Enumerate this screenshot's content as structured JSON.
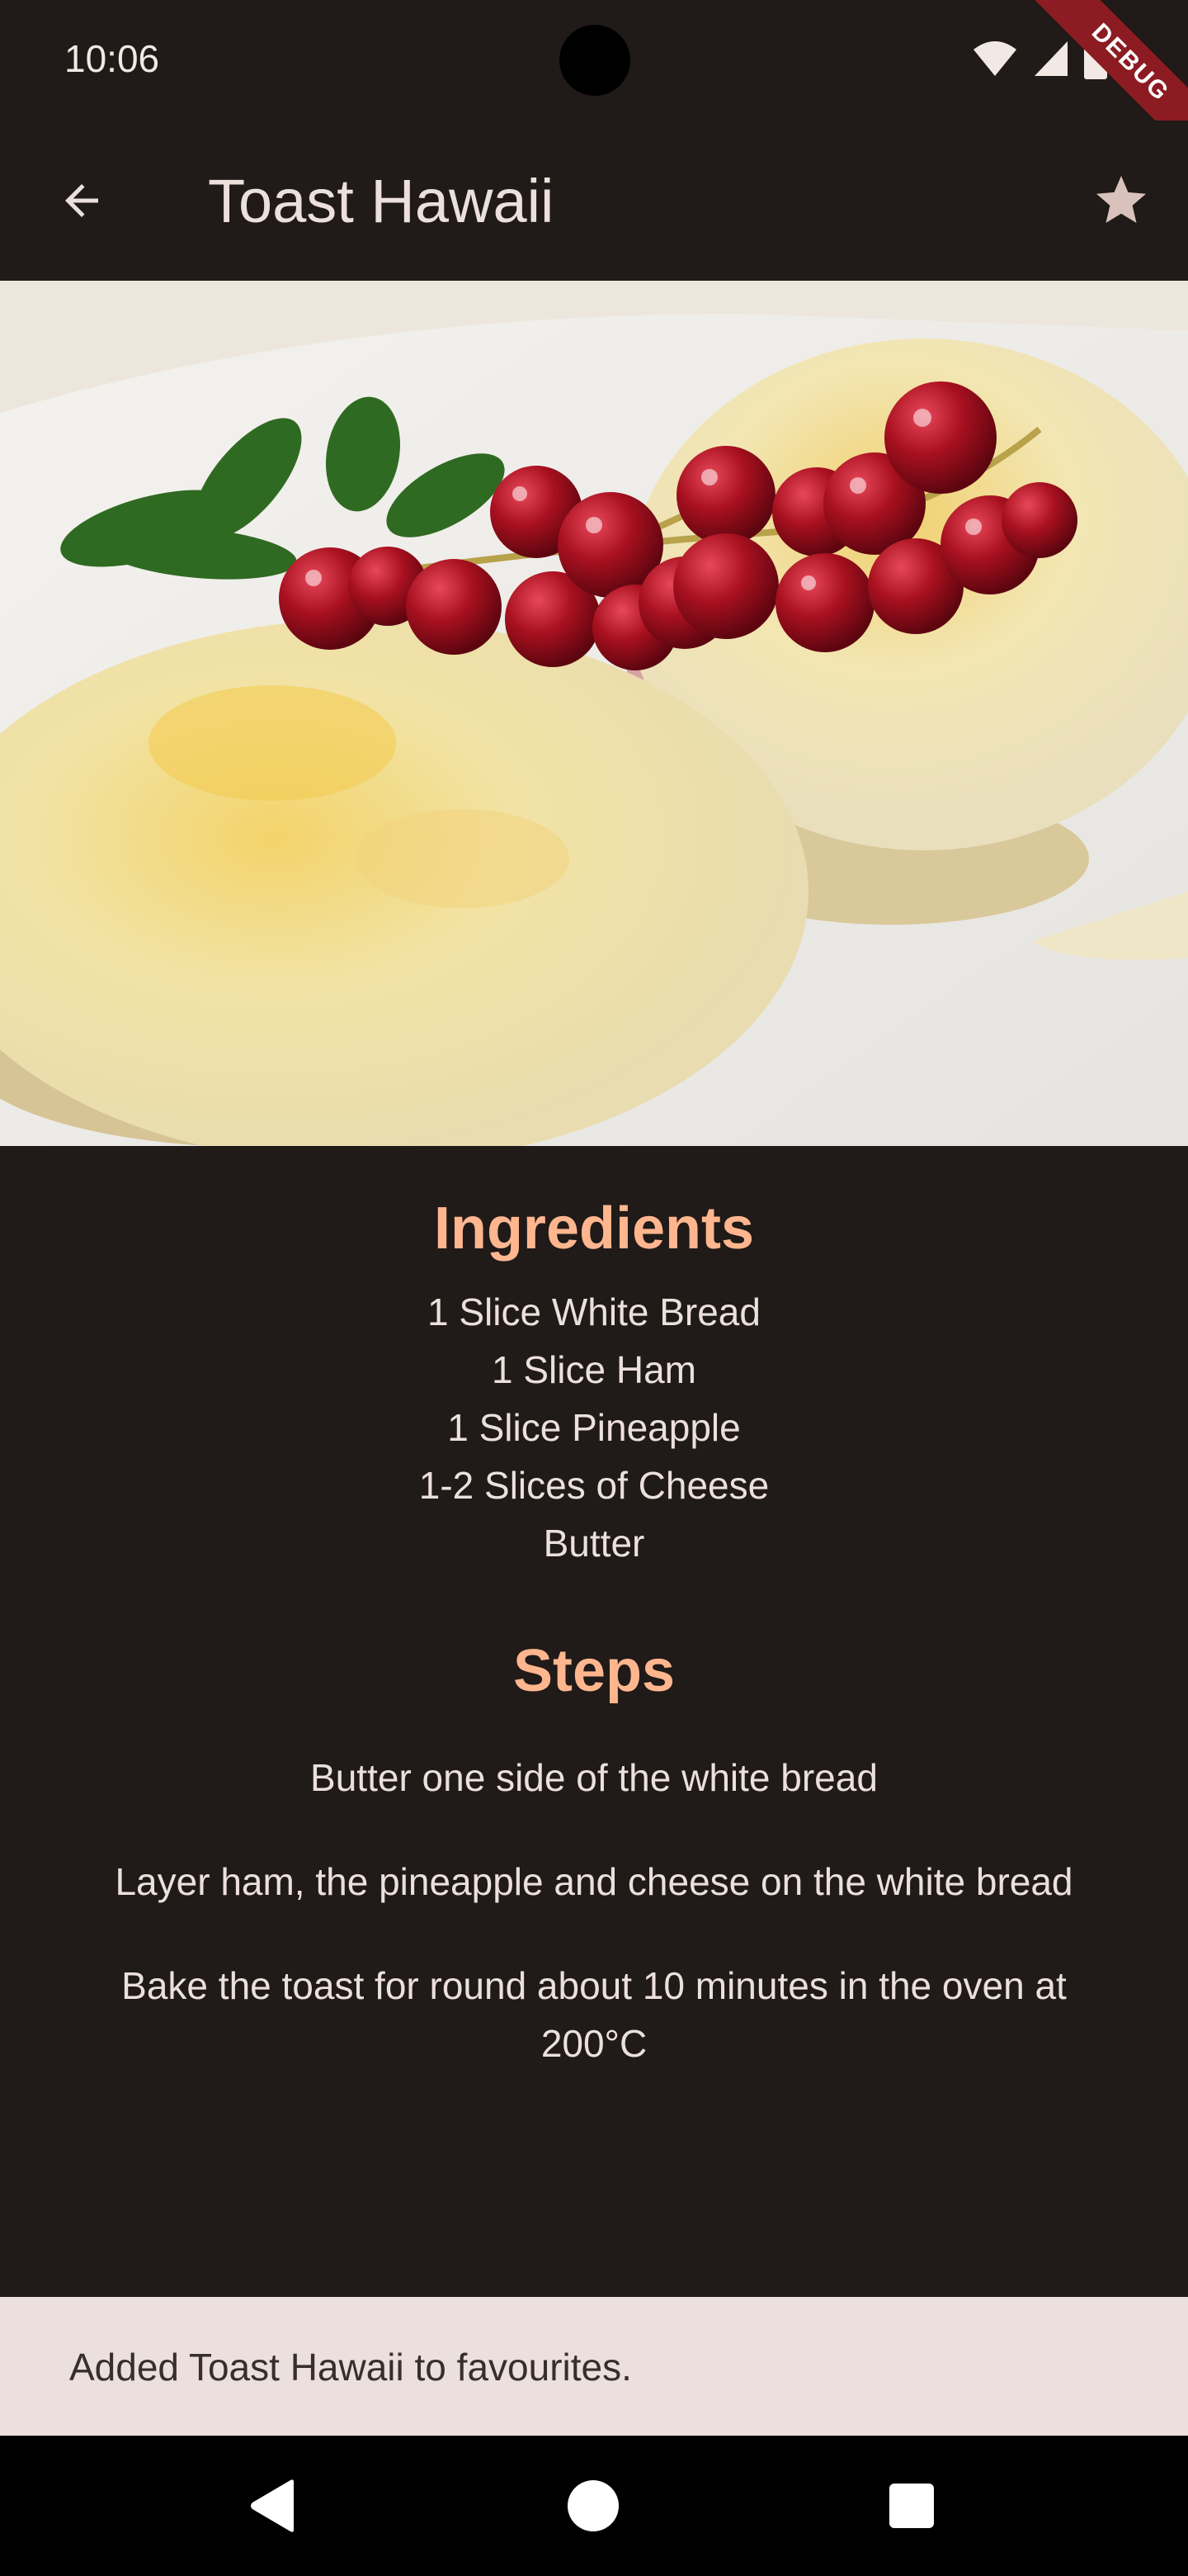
{
  "status_bar": {
    "time": "10:06",
    "icons": [
      "wifi-icon",
      "signal-icon",
      "battery-icon"
    ],
    "debug_banner": "DEBUG"
  },
  "app_bar": {
    "title": "Toast Hawaii",
    "back_icon": "arrow-back-icon",
    "favorite_icon": "star-icon"
  },
  "hero_image": {
    "description_icon": "food-photo"
  },
  "ingredients": {
    "title": "Ingredients",
    "items": [
      "1 Slice White Bread",
      "1 Slice Ham",
      "1 Slice Pineapple",
      "1-2 Slices of Cheese",
      "Butter"
    ]
  },
  "steps": {
    "title": "Steps",
    "items": [
      "Butter one side of the white bread",
      "Layer ham, the pineapple and cheese on the white bread",
      "Bake the toast for round about 10 minutes in the oven at 200°C"
    ]
  },
  "snackbar": {
    "message": "Added Toast Hawaii to favourites."
  },
  "colors": {
    "background": "#201a18",
    "accent": "#ffb68e",
    "text": "#ece0dc",
    "snackbar_bg": "#ece0dc"
  }
}
